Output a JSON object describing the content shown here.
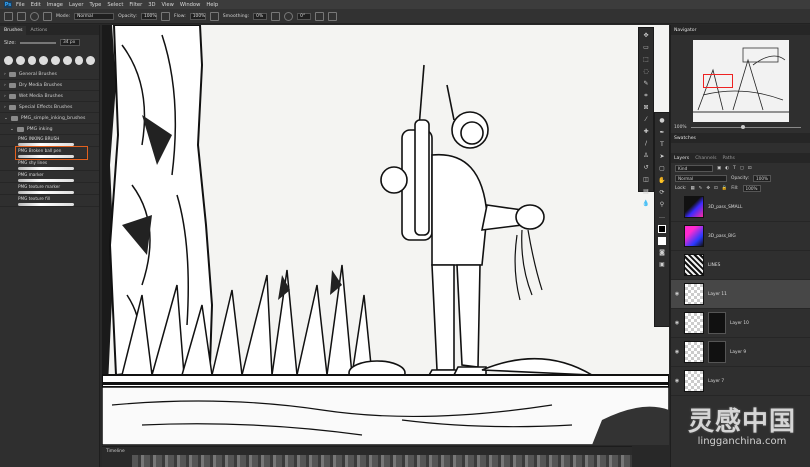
{
  "menu": [
    "File",
    "Edit",
    "Image",
    "Layer",
    "Type",
    "Select",
    "Filter",
    "3D",
    "View",
    "Window",
    "Help"
  ],
  "options": {
    "mode_label": "Mode:",
    "mode_value": "Normal",
    "opacity_label": "Opacity:",
    "opacity_value": "100%",
    "flow_label": "Flow:",
    "flow_value": "100%",
    "smoothing_label": "Smoothing:",
    "smoothing_value": "0%",
    "angle_value": "0°"
  },
  "left_panel": {
    "tabs": [
      "Brushes",
      "Actions"
    ],
    "size_label": "Size:",
    "size_value": "34 px",
    "folders": [
      "General Brushes",
      "Dry Media Brushes",
      "Wet Media Brushes",
      "Special Effects Brushes",
      "PMG_simple_inking_brushes"
    ],
    "subfolder": "PMG inking",
    "brushes": [
      "PMG INKING BRUSH",
      "PMG Broken ball pen",
      "PMG shy lines",
      "PMG marker",
      "PMG texture marker",
      "PMG texture fill"
    ],
    "selected_brush_index": 1
  },
  "timeline": {
    "label": "Timeline"
  },
  "right_panel": {
    "navigator_tab": "Navigator",
    "zoom_value": "100%",
    "swatches_tab": "Swatches",
    "layer_tabs": [
      "Layers",
      "Channels",
      "Paths"
    ],
    "kind_value": "Kind",
    "blend_value": "Normal",
    "opacity_label": "Opacity:",
    "opacity_value": "100%",
    "lock_label": "Lock:",
    "fill_label": "Fill:",
    "fill_value": "100%",
    "layers": [
      {
        "name": "3D_pass_SMALL",
        "selected": false,
        "mask": false
      },
      {
        "name": "3D_pass_BIG",
        "selected": false,
        "mask": false
      },
      {
        "name": "LINES",
        "selected": false,
        "mask": false
      },
      {
        "name": "Layer 11",
        "selected": true,
        "mask": false
      },
      {
        "name": "Layer 10",
        "selected": false,
        "mask": true
      },
      {
        "name": "Layer 9",
        "selected": false,
        "mask": false
      },
      {
        "name": "Layer 7",
        "selected": false,
        "mask": false
      }
    ]
  },
  "watermark": {
    "main": "灵感中国",
    "sub": "lingganchina.com"
  },
  "colors": {
    "accent": "#e2601e",
    "ui_bg": "#2f2f2f",
    "canvas": "#f4f4f2"
  }
}
